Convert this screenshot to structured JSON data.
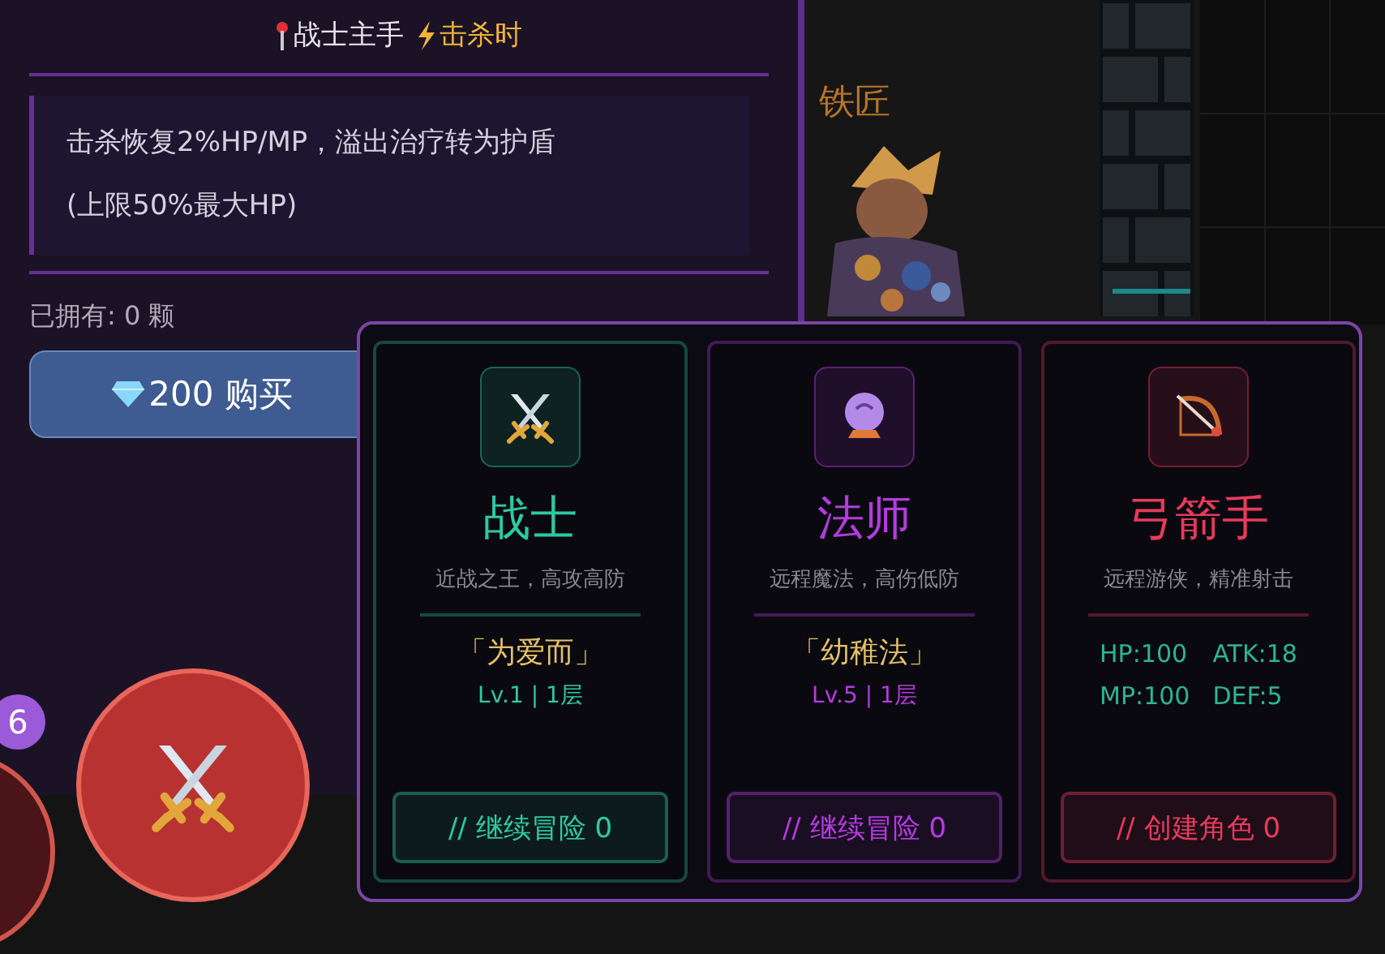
{
  "item": {
    "slot": "战士主手",
    "trigger": "击杀时",
    "description": "击杀恢复2%HP/MP，溢出治疗转为护盾(上限50%最大HP)",
    "owned": "已拥有: 0 颗",
    "buy_button": {
      "price": "200",
      "label": "购买"
    }
  },
  "scene": {
    "npc_label": "铁匠"
  },
  "classes": [
    {
      "kind": "warrior",
      "color": "#2ec9a0",
      "name": "战士",
      "tagline": "近战之王，高攻高防",
      "title": "「为爱而」",
      "level": "Lv.1 | 1层",
      "button": "// 继续冒险 0"
    },
    {
      "kind": "mage",
      "color": "#b43be0",
      "name": "法师",
      "tagline": "远程魔法，高伤低防",
      "title": "「幼稚法」",
      "level": "Lv.5 | 1层",
      "button": "// 继续冒险 0"
    },
    {
      "kind": "archer",
      "color": "#e83a5c",
      "name": "弓箭手",
      "tagline": "远程游侠，精准射击",
      "stats": [
        "HP:100",
        "ATK:18",
        "MP:100",
        "DEF:5"
      ],
      "button": "// 创建角色 0"
    }
  ],
  "action_bar": {
    "badge": "6"
  }
}
